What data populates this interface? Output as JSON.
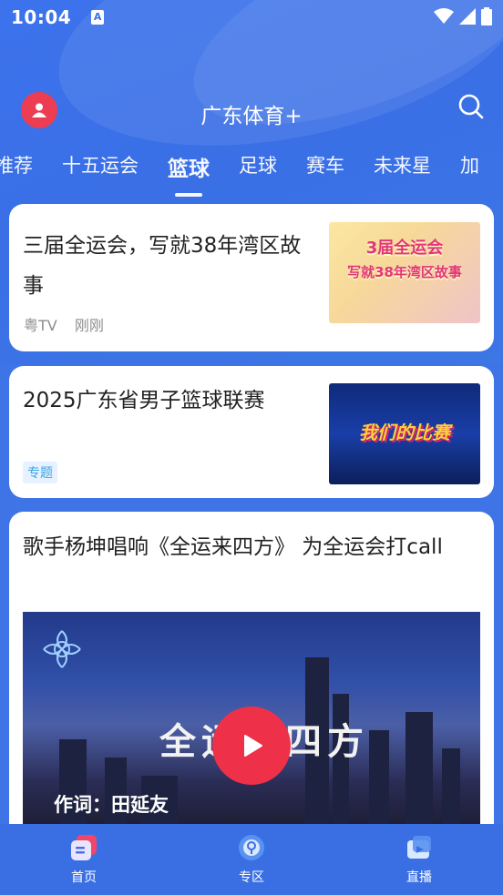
{
  "status_bar": {
    "time": "10:04",
    "app_indicator": "A"
  },
  "header": {
    "title": "广东体育+"
  },
  "tabs": [
    {
      "label": "推荐"
    },
    {
      "label": "十五运会"
    },
    {
      "label": "篮球"
    },
    {
      "label": "足球"
    },
    {
      "label": "赛车"
    },
    {
      "label": "未来星"
    },
    {
      "label": "加"
    }
  ],
  "active_tab": "篮球",
  "feed": [
    {
      "title": "三届全运会，写就38年湾区故事",
      "source": "粤TV",
      "time": "刚刚",
      "thumb_text_line1": "3届全运会",
      "thumb_text_line2": "写就38年湾区故事"
    },
    {
      "title": "2025广东省男子篮球联赛",
      "tag": "专题",
      "thumb_text": "我们的比赛"
    },
    {
      "title": "歌手杨坤唱响《全运来四方》 为全运会打call",
      "video_caption": "全运来四方",
      "video_credit": "作词：田延友"
    }
  ],
  "bottom_nav": [
    {
      "label": "首页",
      "icon": "home-icon",
      "active": true
    },
    {
      "label": "专区",
      "icon": "zone-icon",
      "active": false
    },
    {
      "label": "直播",
      "icon": "live-icon",
      "active": false
    }
  ],
  "colors": {
    "primary": "#3a6fe4",
    "accent": "#ec3d52",
    "tag_text": "#3ea3e6"
  }
}
